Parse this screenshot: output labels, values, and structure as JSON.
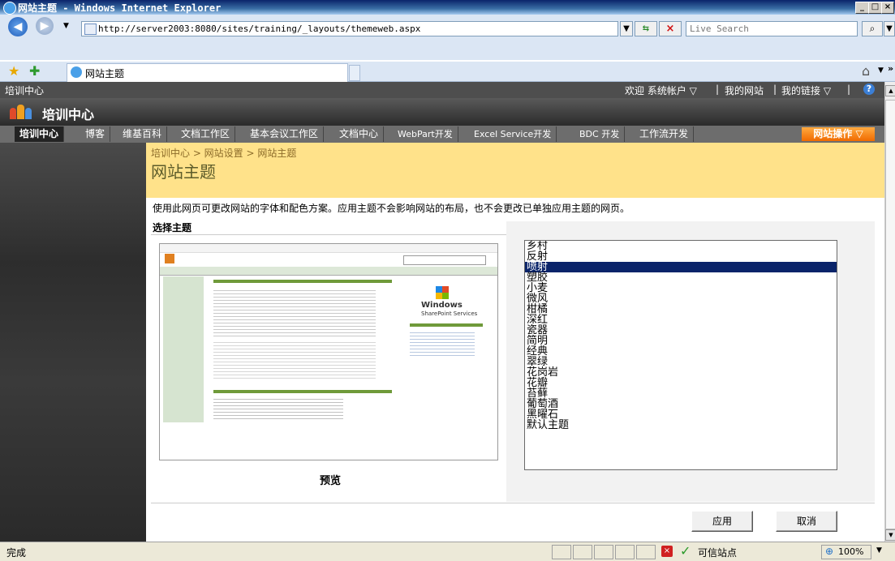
{
  "window": {
    "title": "网站主题 - Windows Internet Explorer",
    "minimize": "_",
    "maximize": "□",
    "close": "×"
  },
  "toolbar": {
    "address": "http://server2003:8080/sites/training/_layouts/themeweb.aspx",
    "search_placeholder": "Live Search",
    "back_glyph": "◀",
    "forward_glyph": "▶",
    "dropdown_glyph": "▼",
    "go_glyph": "⇆",
    "stop_glyph": "×",
    "search_glyph": "⌕",
    "more_glyph": "»",
    "home_glyph": "⌂"
  },
  "tabs": [
    {
      "label": "网站主题"
    }
  ],
  "sharepoint": {
    "site_title_small": "培训中心",
    "welcome": "欢迎 系统帐户 ▽",
    "my_site": "我的网站",
    "my_links": "我的链接 ▽",
    "help_glyph": "?",
    "separator": "|",
    "site_title": "培训中心",
    "site_actions": "网站操作 ▽",
    "nav": [
      "培训中心",
      "博客",
      "维基百科",
      "文档工作区",
      "基本会议工作区",
      "文档中心",
      "WebPart开发",
      "Excel Service开发",
      "BDC 开发",
      "工作流开发"
    ]
  },
  "page": {
    "breadcrumb": "培训中心 > 网站设置 > 网站主题",
    "title": "网站主题",
    "description": "使用此网页可更改网站的字体和配色方案。应用主题不会影响网站的布局，也不会更改已单独应用主题的网页。",
    "select_heading": "选择主题",
    "preview_label": "预览",
    "apply": "应用",
    "cancel": "取消"
  },
  "themes": {
    "options": [
      "乡村",
      "反射",
      "喷射",
      "塑胶",
      "小麦",
      "微风",
      "柑橘",
      "深红",
      "瓷器",
      "简明",
      "经典",
      "翠绿",
      "花岗岩",
      "花瓣",
      "苔藓",
      "葡萄酒",
      "黑曜石",
      "默认主题"
    ],
    "selected": "喷射"
  },
  "preview_mock": {
    "logo_line1": "Windows",
    "logo_line2": "SharePoint Services"
  },
  "status": {
    "text": "完成",
    "zone": "可信站点",
    "zoom": "100%"
  },
  "colors": {
    "selection": "#0a246a",
    "title_area": "#ffe28a",
    "site_actions": "#f06a00"
  }
}
